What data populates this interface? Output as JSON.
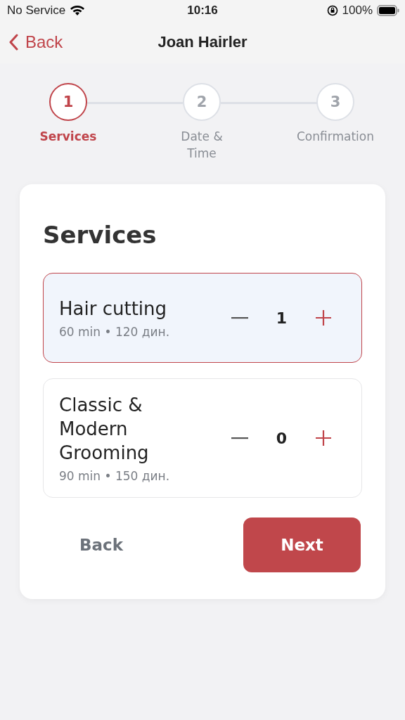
{
  "status_bar": {
    "carrier": "No Service",
    "time": "10:16",
    "battery": "100%"
  },
  "nav": {
    "back": "Back",
    "title": "Joan Hairler"
  },
  "steps": [
    {
      "number": "1",
      "label": "Services",
      "selected": true
    },
    {
      "number": "2",
      "label": "Date &\nTime",
      "selected": false
    },
    {
      "number": "3",
      "label": "Confirmation",
      "selected": false
    }
  ],
  "card": {
    "title": "Services",
    "services": [
      {
        "name": "Hair cutting",
        "details": "60 min • 120 дин.",
        "quantity": "1",
        "selected": true
      },
      {
        "name": "Classic &\nModern\nGrooming",
        "details": "90 min • 150 дин.",
        "quantity": "0",
        "selected": false
      }
    ],
    "back": "Back",
    "next": "Next"
  }
}
